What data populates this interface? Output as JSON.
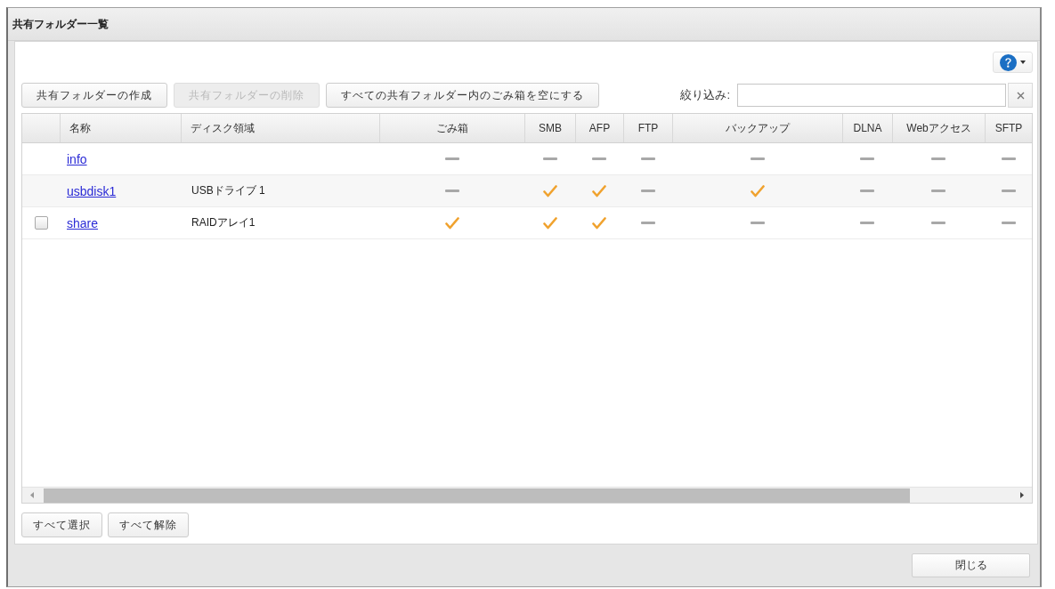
{
  "dialog": {
    "title": "共有フォルダー一覧"
  },
  "toolbar": {
    "buttons": [
      {
        "label": "共有フォルダーの作成",
        "disabled": false
      },
      {
        "label": "共有フォルダーの削除",
        "disabled": true
      },
      {
        "label": "すべての共有フォルダー内のごみ箱を空にする",
        "disabled": false
      }
    ],
    "filter": {
      "label": "絞り込み:"
    }
  },
  "table": {
    "columns": [
      "名称",
      "ディスク領域",
      "ごみ箱",
      "SMB",
      "AFP",
      "FTP",
      "バックアップ",
      "DLNA",
      "Webアクセス",
      "SFTP"
    ],
    "rows": [
      {
        "name": "info",
        "flags": [
          false,
          false,
          false,
          false,
          false,
          false,
          false,
          false
        ]
      },
      {
        "name": "usbdisk1",
        "disk": "USBドライブ 1",
        "flags": [
          false,
          true,
          true,
          false,
          true,
          false,
          false,
          false
        ]
      },
      {
        "name": "share",
        "disk": "RAIDアレイ1",
        "checkbox": {
          "checked": false
        },
        "flags": [
          true,
          true,
          true,
          false,
          false,
          false,
          false,
          false
        ]
      }
    ]
  },
  "selection_buttons": [
    "すべて選択",
    "すべて解除"
  ],
  "close_button": "閉じる"
}
